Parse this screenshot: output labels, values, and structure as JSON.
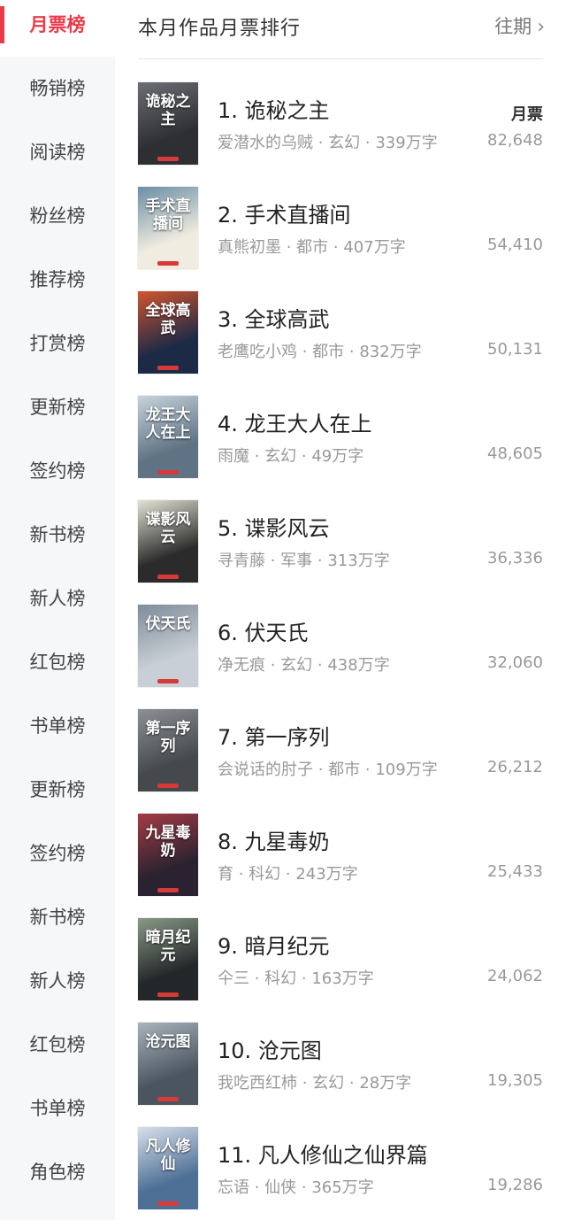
{
  "sidebar": {
    "items": [
      {
        "label": "月票榜",
        "active": true
      },
      {
        "label": "畅销榜"
      },
      {
        "label": "阅读榜"
      },
      {
        "label": "粉丝榜"
      },
      {
        "label": "推荐榜"
      },
      {
        "label": "打赏榜"
      },
      {
        "label": "更新榜"
      },
      {
        "label": "签约榜"
      },
      {
        "label": "新书榜"
      },
      {
        "label": "新人榜"
      },
      {
        "label": "红包榜"
      },
      {
        "label": "书单榜"
      },
      {
        "label": "更新榜"
      },
      {
        "label": "签约榜"
      },
      {
        "label": "新书榜"
      },
      {
        "label": "新人榜"
      },
      {
        "label": "红包榜"
      },
      {
        "label": "书单榜"
      },
      {
        "label": "角色榜"
      }
    ]
  },
  "header": {
    "title": "本月作品月票排行",
    "history_label": "往期",
    "chevron": "›"
  },
  "list": {
    "vote_header": "月票",
    "separator": " · ",
    "books": [
      {
        "rank": "1.",
        "name": "诡秘之主",
        "author": "爱潜水的乌贼",
        "genre": "玄幻",
        "words": "339万字",
        "votes": "82,648",
        "cover_text": "诡秘之主",
        "cover_bg": "#2e2f33",
        "cover_accent": "#6b6e73"
      },
      {
        "rank": "2.",
        "name": "手术直播间",
        "author": "真熊初墨",
        "genre": "都市",
        "words": "407万字",
        "votes": "54,410",
        "cover_text": "手术直播间",
        "cover_bg": "#f1ece0",
        "cover_accent": "#6b8fa5"
      },
      {
        "rank": "3.",
        "name": "全球高武",
        "author": "老鹰吃小鸡",
        "genre": "都市",
        "words": "832万字",
        "votes": "50,131",
        "cover_text": "全球高武",
        "cover_bg": "#1d2a46",
        "cover_accent": "#d0552e"
      },
      {
        "rank": "4.",
        "name": "龙王大人在上",
        "author": "雨魔",
        "genre": "玄幻",
        "words": "49万字",
        "votes": "48,605",
        "cover_text": "龙王大人在上",
        "cover_bg": "#5f7384",
        "cover_accent": "#c7d3dc"
      },
      {
        "rank": "5.",
        "name": "谍影风云",
        "author": "寻青藤",
        "genre": "军事",
        "words": "313万字",
        "votes": "36,336",
        "cover_text": "谍影风云",
        "cover_bg": "#2b2b2b",
        "cover_accent": "#e3e3d5"
      },
      {
        "rank": "6.",
        "name": "伏天氏",
        "author": "净无痕",
        "genre": "玄幻",
        "words": "438万字",
        "votes": "32,060",
        "cover_text": "伏天氏",
        "cover_bg": "#c9cfd6",
        "cover_accent": "#7e8c99"
      },
      {
        "rank": "7.",
        "name": "第一序列",
        "author": "会说话的肘子",
        "genre": "都市",
        "words": "109万字",
        "votes": "26,212",
        "cover_text": "第一序列",
        "cover_bg": "#45484c",
        "cover_accent": "#8c8f93"
      },
      {
        "rank": "8.",
        "name": "九星毒奶",
        "author": "育",
        "genre": "科幻",
        "words": "243万字",
        "votes": "25,433",
        "cover_text": "九星毒奶",
        "cover_bg": "#2a2230",
        "cover_accent": "#a43c45"
      },
      {
        "rank": "9.",
        "name": "暗月纪元",
        "author": "仐三",
        "genre": "科幻",
        "words": "163万字",
        "votes": "24,062",
        "cover_text": "暗月纪元",
        "cover_bg": "#23272a",
        "cover_accent": "#8a9a86"
      },
      {
        "rank": "10.",
        "name": "沧元图",
        "author": "我吃西红柿",
        "genre": "玄幻",
        "words": "28万字",
        "votes": "19,305",
        "cover_text": "沧元图",
        "cover_bg": "#4b5560",
        "cover_accent": "#a9b3bc"
      },
      {
        "rank": "11.",
        "name": "凡人修仙之仙界篇",
        "author": "忘语",
        "genre": "仙侠",
        "words": "365万字",
        "votes": "19,286",
        "cover_text": "凡人修仙",
        "cover_bg": "#4d6f96",
        "cover_accent": "#d8e0ea"
      }
    ]
  },
  "colors": {
    "accent": "#ec3a4a",
    "sidebar_bg": "#f6f7f9",
    "meta_text": "#999999"
  }
}
